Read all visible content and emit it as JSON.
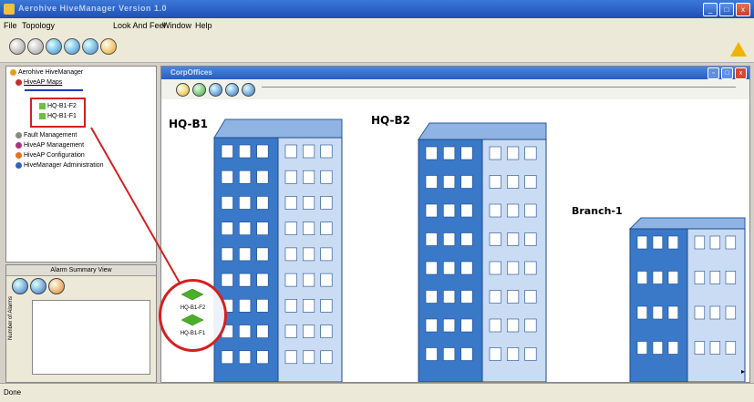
{
  "window": {
    "title": "Aerohive HiveManager Version 1.0",
    "minimize": "_",
    "maximize": "□",
    "close": "x"
  },
  "menu": [
    "File",
    "Topology",
    "Look And Feel",
    "Window",
    "Help"
  ],
  "tree": {
    "root": "Aerohive HiveManager",
    "maps": "HiveAP Maps",
    "floors": [
      "HQ-B1-F2",
      "HQ-B1-F1"
    ],
    "others": [
      "Fault Management",
      "HiveAP Management",
      "HiveAP Configuration",
      "HiveManager Administration"
    ]
  },
  "alarm": {
    "title": "Alarm Summary View",
    "ylabel": "Number of Alarms"
  },
  "map": {
    "title": "CorpOffices",
    "buildings": [
      {
        "name": "HQ-B1",
        "floors": 9
      },
      {
        "name": "HQ-B2",
        "floors": 8
      },
      {
        "name": "Branch-1",
        "floors": 4
      }
    ]
  },
  "callout": {
    "floors": [
      "HQ-B1-F2",
      "HQ-B1-F1"
    ]
  },
  "status": "Done",
  "colors": {
    "building": "#3a78c8",
    "building_light": "#c9dcf4",
    "highlight": "#d42020",
    "floor_icon": "#4caf2a"
  }
}
